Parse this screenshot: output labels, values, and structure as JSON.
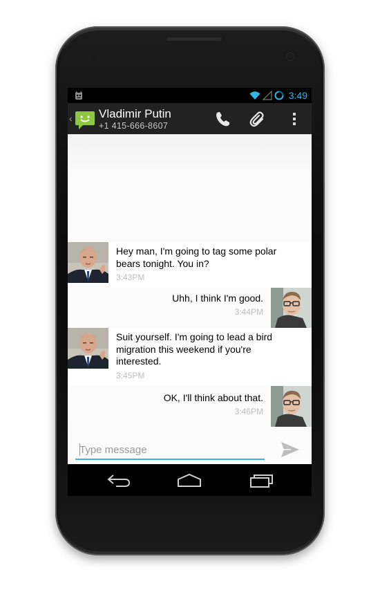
{
  "status_bar": {
    "time": "3:49",
    "notification_icon": "cyanogenmod-icon",
    "icons": [
      "wifi-icon",
      "signal-icon",
      "battery-icon"
    ],
    "accent_color": "#33b5e5"
  },
  "action_bar": {
    "contact_name": "Vladimir Putin",
    "contact_phone": "+1 415-666-8607",
    "app_icon": "chat-bubble-icon",
    "actions": [
      "phone-icon",
      "attachment-icon",
      "overflow-menu-icon"
    ]
  },
  "messages": [
    {
      "direction": "incoming",
      "text_line1": "Hey man, I'm going to tag some polar",
      "text_line2": "bears tonight. You in?",
      "time": "3:43PM",
      "avatar": "contact-avatar"
    },
    {
      "direction": "outgoing",
      "text": "Uhh, I think I'm good.",
      "time": "3:44PM",
      "avatar": "self-avatar"
    },
    {
      "direction": "incoming",
      "text_line1": "Suit yourself. I'm going to lead a bird",
      "text_line2": "migration this weekend if you're",
      "text_line3": "interested.",
      "time": "3:45PM",
      "avatar": "contact-avatar"
    },
    {
      "direction": "outgoing",
      "text": "OK, I'll think about that.",
      "time": "3:46PM",
      "avatar": "self-avatar"
    }
  ],
  "compose": {
    "placeholder": "Type message",
    "send_icon": "send-icon"
  },
  "nav_bar": [
    "back-icon",
    "home-icon",
    "recents-icon"
  ]
}
